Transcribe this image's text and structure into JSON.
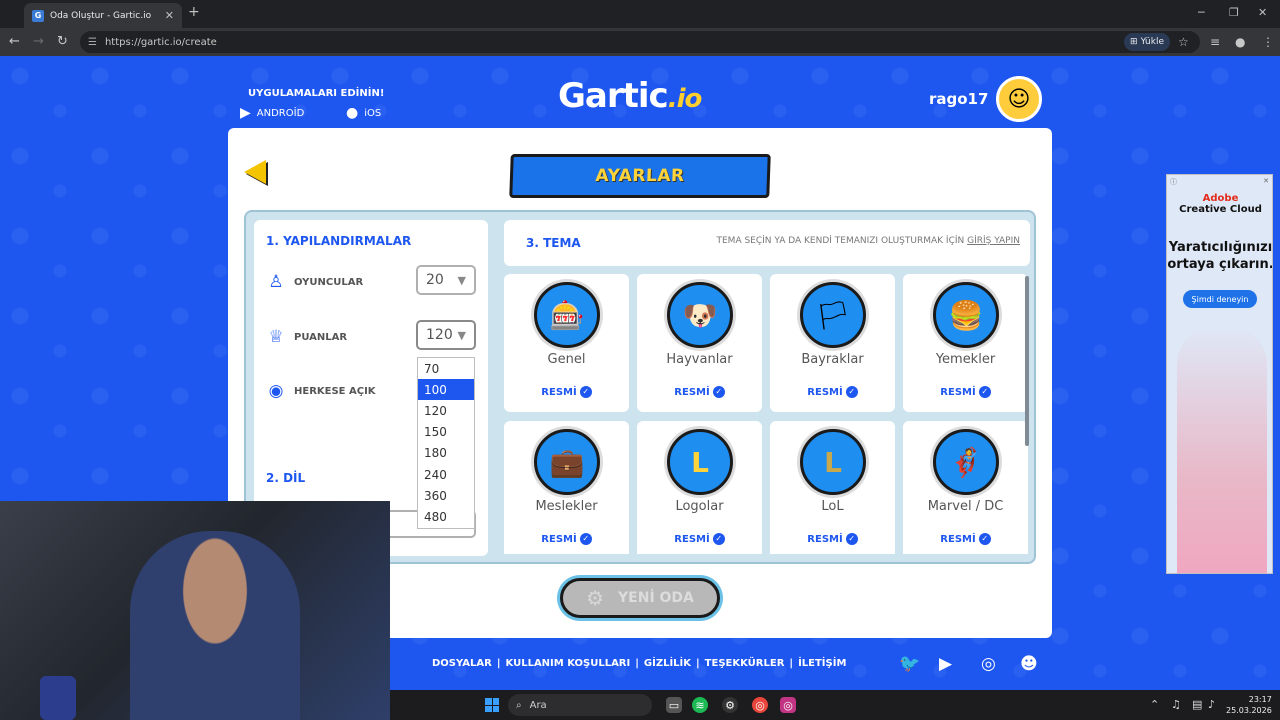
{
  "browser": {
    "tab_title": "Oda Oluştur - Gartic.io",
    "url": "https://gartic.io/create",
    "install_label": "Yükle"
  },
  "header": {
    "get_apps": "UYGULAMALARI EDİNİN!",
    "android_label": "ANDROİD",
    "ios_label": "iOS",
    "logo_main": "Gartic",
    "logo_suffix": ".io",
    "username": "rago17"
  },
  "settings": {
    "ribbon_title": "AYARLAR",
    "config_title": "1. YAPILANDIRMALAR",
    "players_label": "OYUNCULAR",
    "players_value": "20",
    "points_label": "PUANLAR",
    "points_value": "120",
    "public_label": "HERKESE AÇIK",
    "language_title": "2. DİL",
    "points_options": [
      "70",
      "100",
      "120",
      "150",
      "180",
      "240",
      "360",
      "480"
    ],
    "points_highlighted": "100"
  },
  "theme": {
    "title": "3. TEMA",
    "note_prefix": "TEMA SEÇİN YA DA KENDİ TEMANIZI OLUŞTURMAK İÇİN ",
    "note_link": "GİRİŞ YAPIN",
    "badge": "RESMİ",
    "cards": [
      {
        "name": "Genel",
        "icon": "slot-machine-icon"
      },
      {
        "name": "Hayvanlar",
        "icon": "dog-icon"
      },
      {
        "name": "Bayraklar",
        "icon": "flag-icon"
      },
      {
        "name": "Yemekler",
        "icon": "burger-icon"
      },
      {
        "name": "Meslekler",
        "icon": "briefcase-icon"
      },
      {
        "name": "Logolar",
        "icon": "logo-icon"
      },
      {
        "name": "LoL",
        "icon": "lol-icon"
      },
      {
        "name": "Marvel / DC",
        "icon": "mask-icon"
      }
    ]
  },
  "actions": {
    "new_room": "YENİ ODA"
  },
  "footer": {
    "links": [
      "DOSYALAR",
      "KULLANIM KOŞULLARI",
      "GİZLİLİK",
      "TEŞEKKÜRLER",
      "İLETİŞİM"
    ]
  },
  "ad": {
    "brand_line1": "Adobe",
    "brand_line2": "Creative Cloud",
    "headline": "Yaratıcılığınızı ortaya çıkarın.",
    "cta": "Şimdi deneyin"
  },
  "taskbar": {
    "search_placeholder": "Ara",
    "time": "23:17",
    "date": "25.03.2026"
  },
  "colors": {
    "brand_blue": "#1e57f0",
    "accent_yellow": "#ffd43b"
  }
}
